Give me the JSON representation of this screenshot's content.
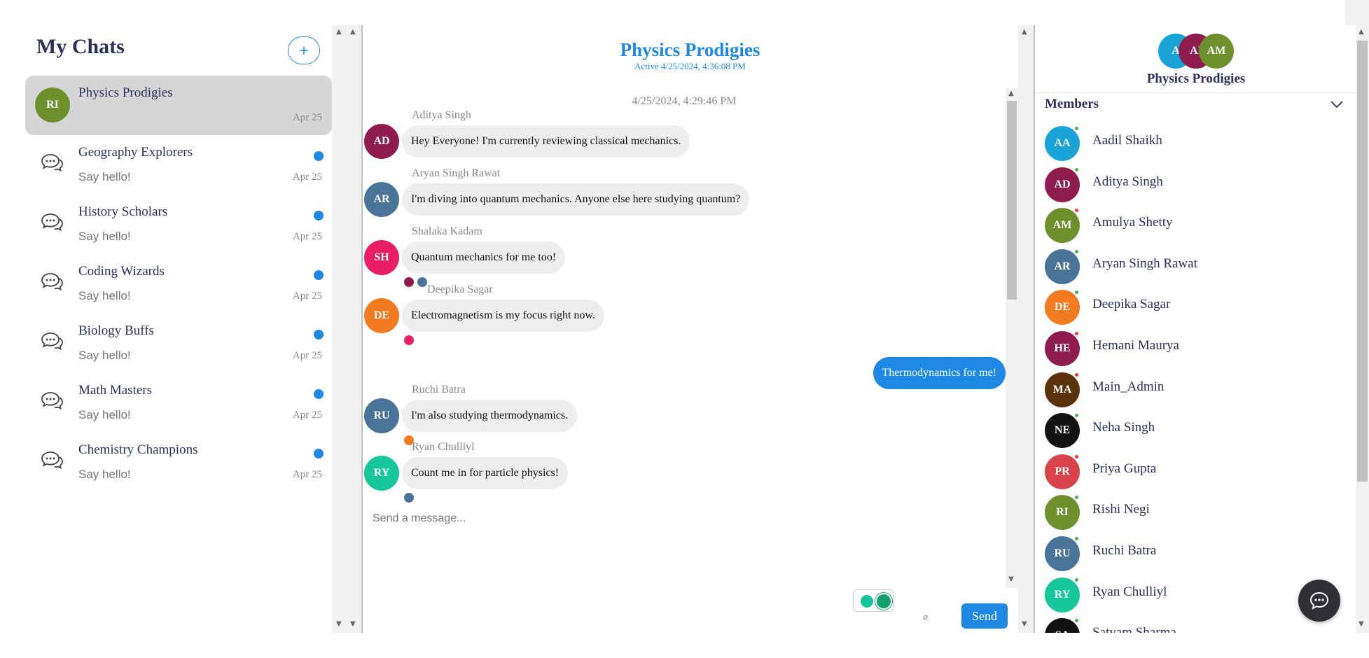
{
  "sidebar": {
    "title": "My Chats",
    "add_label": "+",
    "chats": [
      {
        "name": "Physics Prodigies",
        "preview": "",
        "date": "Apr 25",
        "avatar": "RI",
        "avatar_color": "#6d8f2c",
        "active": true,
        "unread": false
      },
      {
        "name": "Geography Explorers",
        "preview": "Say hello!",
        "date": "Apr 25",
        "unread": true
      },
      {
        "name": "History Scholars",
        "preview": "Say hello!",
        "date": "Apr 25",
        "unread": true
      },
      {
        "name": "Coding Wizards",
        "preview": "Say hello!",
        "date": "Apr 25",
        "unread": true
      },
      {
        "name": "Biology Buffs",
        "preview": "Say hello!",
        "date": "Apr 25",
        "unread": true
      },
      {
        "name": "Math Masters",
        "preview": "Say hello!",
        "date": "Apr 25",
        "unread": true
      },
      {
        "name": "Chemistry Champions",
        "preview": "Say hello!",
        "date": "Apr 25",
        "unread": true
      }
    ]
  },
  "chat": {
    "title": "Physics Prodigies",
    "active_status": "Active 4/25/2024, 4:36:08 PM",
    "timestamp": "4/25/2024, 4:29:46 PM",
    "input_placeholder": "Send a message...",
    "send_label": "Send",
    "messages": [
      {
        "sender": "Aditya Singh",
        "initials": "AD",
        "color": "#8e1c4e",
        "text": "Hey Everyone! I'm currently reviewing classical mechanics.",
        "reads": []
      },
      {
        "sender": "Aryan Singh Rawat",
        "initials": "AR",
        "color": "#4a7398",
        "text": "I'm diving into quantum mechanics. Anyone else here studying quantum?",
        "reads": []
      },
      {
        "sender": "Shalaka Kadam",
        "initials": "SH",
        "color": "#e91e63",
        "text": "Quantum mechanics for me too!",
        "reads": [
          "#8e1c4e",
          "#4a7398"
        ]
      },
      {
        "sender": "Deepika Sagar",
        "initials": "DE",
        "color": "#f27b22",
        "text": "Electromagnetism is my focus right now.",
        "reads": [
          "#e91e63"
        ]
      },
      {
        "sender": "",
        "initials": "",
        "color": "#1e88e5",
        "text": "Thermodynamics for me!",
        "mine": true,
        "reads": []
      },
      {
        "sender": "Ruchi Batra",
        "initials": "RU",
        "color": "#4a7398",
        "text": "I'm also studying thermodynamics.",
        "reads": [
          "#f27b22"
        ]
      },
      {
        "sender": "Ryan Chulliyl",
        "initials": "RY",
        "color": "#16c79a",
        "text": "Count me in for particle physics!",
        "reads": [
          "#4a7398"
        ]
      }
    ]
  },
  "group": {
    "name": "Physics Prodigies",
    "avatars": [
      {
        "initials": "A",
        "color": "#1aa3d9"
      },
      {
        "initials": "AI",
        "color": "#8e1c4e"
      },
      {
        "initials": "AM",
        "color": "#6d8f2c"
      }
    ],
    "members_title": "Members",
    "members": [
      {
        "name": "Aadil Shaikh",
        "initials": "AA",
        "color": "#1aa3d9",
        "status": "#4caf50"
      },
      {
        "name": "Aditya Singh",
        "initials": "AD",
        "color": "#8e1c4e",
        "status": "#4caf50"
      },
      {
        "name": "Amulya Shetty",
        "initials": "AM",
        "color": "#6d8f2c",
        "status": "#e53935"
      },
      {
        "name": "Aryan Singh Rawat",
        "initials": "AR",
        "color": "#4a7398",
        "status": "#4caf50"
      },
      {
        "name": "Deepika Sagar",
        "initials": "DE",
        "color": "#f27b22",
        "status": "#4caf50"
      },
      {
        "name": "Hemani Maurya",
        "initials": "HE",
        "color": "#8e1c4e",
        "status": "#e53935"
      },
      {
        "name": "Main_Admin",
        "initials": "MA",
        "color": "#5a3209",
        "status": "#e53935"
      },
      {
        "name": "Neha Singh",
        "initials": "NE",
        "color": "#111111",
        "status": "#4caf50"
      },
      {
        "name": "Priya Gupta",
        "initials": "PR",
        "color": "#d9434b",
        "status": "#e53935"
      },
      {
        "name": "Rishi Negi",
        "initials": "RI",
        "color": "#6d8f2c",
        "status": "#4caf50"
      },
      {
        "name": "Ruchi Batra",
        "initials": "RU",
        "color": "#4a7398",
        "status": "#4caf50"
      },
      {
        "name": "Ryan Chulliyl",
        "initials": "RY",
        "color": "#16c79a",
        "status": "#4caf50"
      },
      {
        "name": "Satyam Sharma",
        "initials": "SA",
        "color": "#111111",
        "status": "#4caf50"
      }
    ]
  },
  "icons": {
    "chat_group": "chat-bubbles-icon",
    "chevron": "chevron-down-icon",
    "fab": "chat-support-icon",
    "attach": "paperclip-icon",
    "grammarly": "grammarly-icon"
  }
}
